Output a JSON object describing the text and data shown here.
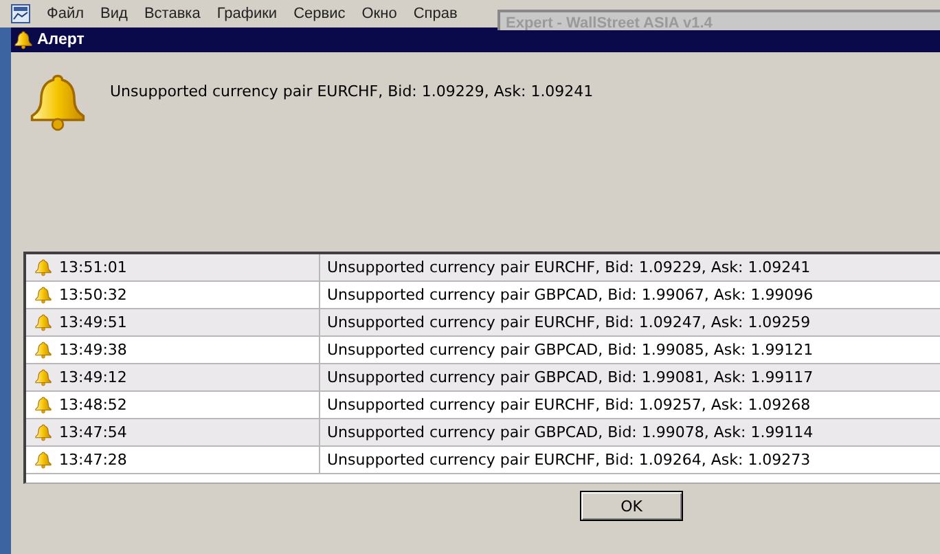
{
  "menu_bar": {
    "items": [
      "Файл",
      "Вид",
      "Вставка",
      "Графики",
      "Сервис",
      "Окно",
      "Справ"
    ]
  },
  "background_window": {
    "title": "Expert - WallStreet ASIA v1.4"
  },
  "dialog": {
    "title": "Алерт",
    "message": "Unsupported currency pair EURCHF, Bid: 1.09229, Ask: 1.09241"
  },
  "alerts": [
    {
      "time": "13:51:01",
      "message": "Unsupported currency pair EURCHF, Bid: 1.09229, Ask: 1.09241"
    },
    {
      "time": "13:50:32",
      "message": "Unsupported currency pair GBPCAD, Bid: 1.99067, Ask: 1.99096"
    },
    {
      "time": "13:49:51",
      "message": "Unsupported currency pair EURCHF, Bid: 1.09247, Ask: 1.09259"
    },
    {
      "time": "13:49:38",
      "message": "Unsupported currency pair GBPCAD, Bid: 1.99085, Ask: 1.99121"
    },
    {
      "time": "13:49:12",
      "message": "Unsupported currency pair GBPCAD, Bid: 1.99081, Ask: 1.99117"
    },
    {
      "time": "13:48:52",
      "message": "Unsupported currency pair EURCHF, Bid: 1.09257, Ask: 1.09268"
    },
    {
      "time": "13:47:54",
      "message": "Unsupported currency pair GBPCAD, Bid: 1.99078, Ask: 1.99114"
    },
    {
      "time": "13:47:28",
      "message": "Unsupported currency pair EURCHF, Bid: 1.09264, Ask: 1.09273"
    }
  ],
  "buttons": [
    "OK"
  ]
}
